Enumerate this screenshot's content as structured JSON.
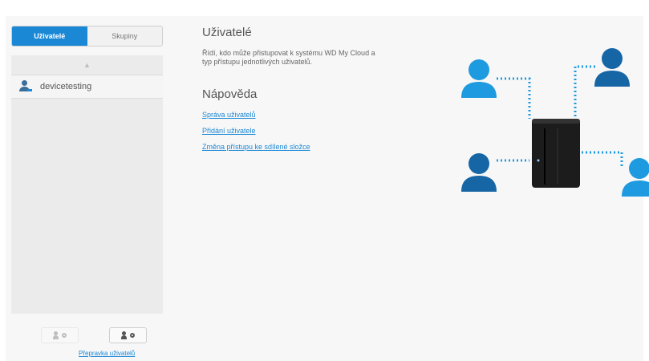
{
  "tabs": [
    {
      "label": "Uživatelé",
      "active": true
    },
    {
      "label": "Skupiny",
      "active": false
    }
  ],
  "users": [
    {
      "name": "devicetesting"
    }
  ],
  "sync_link": "Přepravka uživatelů",
  "main": {
    "title": "Uživatelé",
    "description": "Řídí, kdo může přistupovat k systému WD My Cloud a typ přístupu jednotlivých uživatelů.",
    "help_title": "Nápověda",
    "help_links": [
      "Správa uživatelů",
      "Přidání uživatele",
      "Změna přístupu ke sdílené složce"
    ]
  },
  "colors": {
    "accent": "#1b88d6",
    "user_dark": "#1666a6",
    "user_light": "#1e9ae0",
    "device": "#1c1c1c"
  }
}
